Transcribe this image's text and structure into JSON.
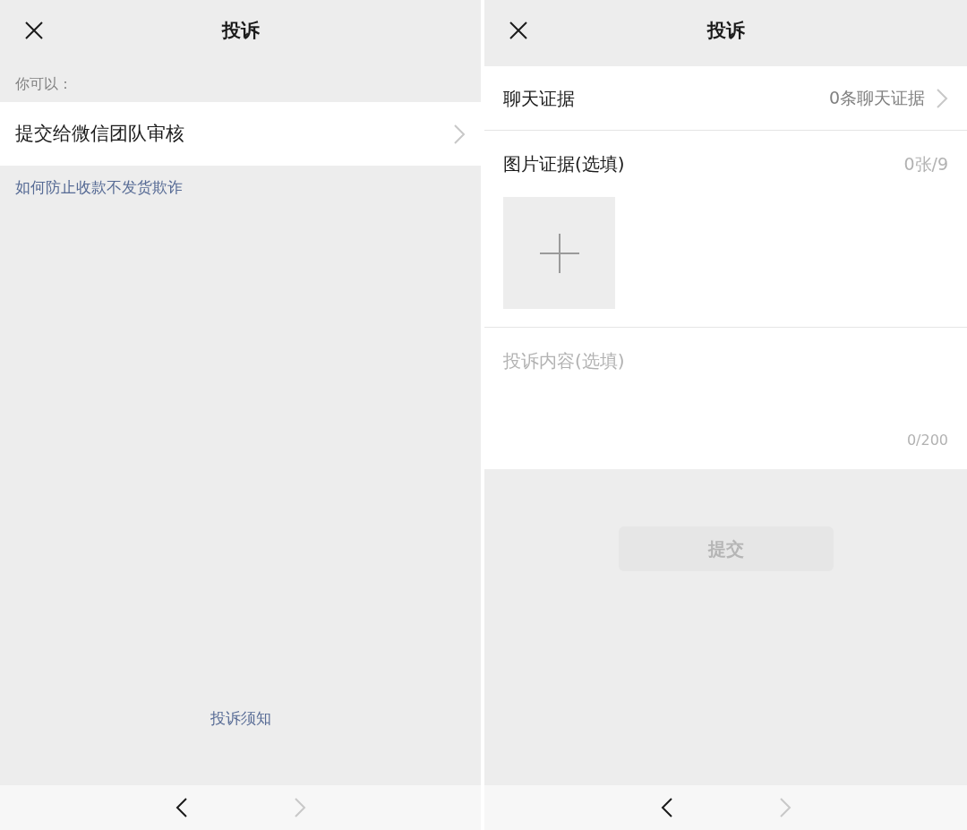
{
  "left_screen": {
    "title": "投诉",
    "section_label": "你可以：",
    "option": {
      "label": "提交给微信团队审核"
    },
    "help_link": "如何防止收款不发货欺诈",
    "footer_link": "投诉须知",
    "nav": {
      "back_disabled": false,
      "forward_disabled": true
    }
  },
  "right_screen": {
    "title": "投诉",
    "chat_evidence": {
      "label": "聊天证据",
      "value": "0条聊天证据"
    },
    "image_evidence": {
      "label": "图片证据(选填)",
      "count": "0张/9"
    },
    "content": {
      "placeholder": "投诉内容(选填)",
      "counter": "0/200"
    },
    "submit": {
      "label": "提交",
      "disabled": true
    },
    "nav": {
      "back_disabled": false,
      "forward_disabled": true
    }
  }
}
